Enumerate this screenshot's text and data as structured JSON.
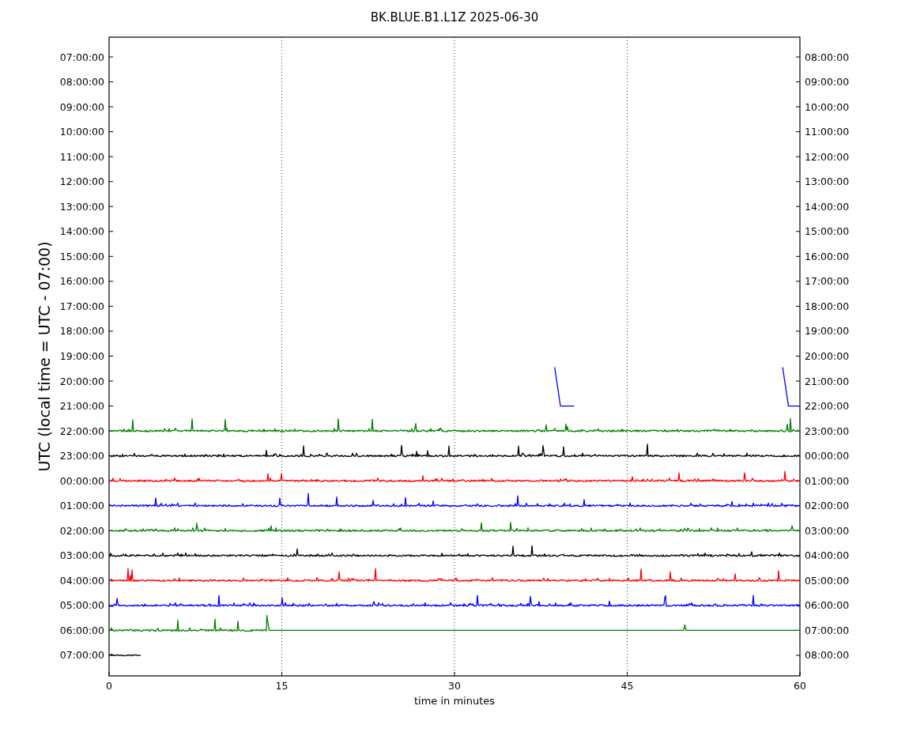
{
  "title": "BK.BLUE.B1.L1Z 2025-06-30",
  "ylabel": "UTC (local time = UTC - 07:00)",
  "xlabel": "time in minutes",
  "xticks": [
    "0",
    "15",
    "30",
    "45",
    "60"
  ],
  "left_labels": [
    "07:00:00",
    "08:00:00",
    "09:00:00",
    "10:00:00",
    "11:00:00",
    "12:00:00",
    "13:00:00",
    "14:00:00",
    "15:00:00",
    "16:00:00",
    "17:00:00",
    "18:00:00",
    "19:00:00",
    "20:00:00",
    "21:00:00",
    "22:00:00",
    "23:00:00",
    "00:00:00",
    "01:00:00",
    "02:00:00",
    "03:00:00",
    "04:00:00",
    "05:00:00",
    "06:00:00",
    "07:00:00"
  ],
  "right_labels": [
    "08:00:00",
    "09:00:00",
    "10:00:00",
    "11:00:00",
    "12:00:00",
    "13:00:00",
    "14:00:00",
    "15:00:00",
    "16:00:00",
    "17:00:00",
    "18:00:00",
    "19:00:00",
    "20:00:00",
    "21:00:00",
    "22:00:00",
    "23:00:00",
    "00:00:00",
    "01:00:00",
    "02:00:00",
    "03:00:00",
    "04:00:00",
    "05:00:00",
    "06:00:00",
    "07:00:00",
    "08:00:00"
  ],
  "traces": [
    {
      "kind": "steps",
      "color": "#0000ff"
    },
    {
      "kind": "full",
      "color": "#008000"
    },
    {
      "kind": "full",
      "color": "#000000"
    },
    {
      "kind": "full",
      "color": "#ff0000"
    },
    {
      "kind": "full",
      "color": "#0000ff"
    },
    {
      "kind": "full",
      "color": "#008000"
    },
    {
      "kind": "full",
      "color": "#000000"
    },
    {
      "kind": "full",
      "color": "#ff0000"
    },
    {
      "kind": "full",
      "color": "#0000ff"
    },
    {
      "kind": "quiet-end",
      "color": "#008000"
    },
    {
      "kind": "short",
      "color": "#000000"
    }
  ]
}
